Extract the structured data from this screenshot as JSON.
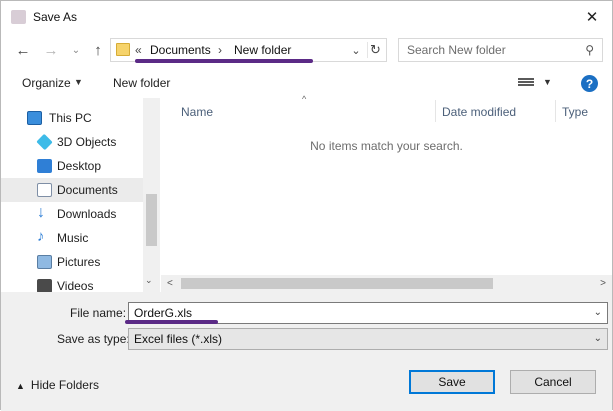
{
  "window": {
    "title": "Save As",
    "close_label": "✕"
  },
  "nav": {
    "back": "←",
    "forward": "→",
    "recent": "⌄",
    "up": "↑"
  },
  "address": {
    "prefix": "«",
    "crumbs": [
      "Documents",
      "New folder"
    ],
    "separator": "›"
  },
  "search": {
    "placeholder": "Search New folder"
  },
  "toolbar": {
    "organize_label": "Organize",
    "new_folder_label": "New folder"
  },
  "sidebar": {
    "items": [
      {
        "label": "This PC",
        "icon": "computer-icon"
      },
      {
        "label": "3D Objects",
        "icon": "3d-objects-icon"
      },
      {
        "label": "Desktop",
        "icon": "desktop-icon"
      },
      {
        "label": "Documents",
        "icon": "documents-icon",
        "selected": true
      },
      {
        "label": "Downloads",
        "icon": "downloads-icon"
      },
      {
        "label": "Music",
        "icon": "music-icon"
      },
      {
        "label": "Pictures",
        "icon": "pictures-icon"
      },
      {
        "label": "Videos",
        "icon": "videos-icon"
      }
    ]
  },
  "columns": {
    "name": "Name",
    "date_modified": "Date modified",
    "type": "Type"
  },
  "main": {
    "empty_message": "No items match your search."
  },
  "form": {
    "file_name_label": "File name:",
    "file_name_value": "OrderG.xls",
    "save_type_label": "Save as type:",
    "save_type_value": "Excel files (*.xls)"
  },
  "footer": {
    "hide_folders_label": "Hide Folders",
    "save_label": "Save",
    "cancel_label": "Cancel"
  },
  "colors": {
    "accent": "#0078d7",
    "annotation": "#5b2a86",
    "help": "#1b6fc3",
    "folder": "#f6d36b"
  }
}
